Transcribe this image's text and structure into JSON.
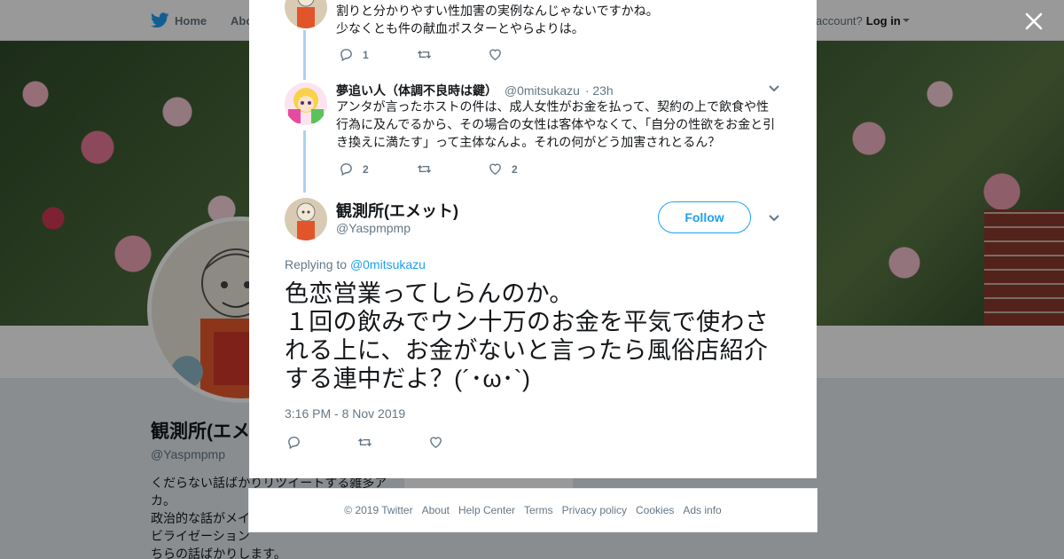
{
  "topbar": {
    "home_label": "Home",
    "about_label": "About",
    "account_prompt": "account?",
    "login_label": "Log in"
  },
  "profile_bg": {
    "name": "観測所(エメット)",
    "handle": "@Yaspmpmp",
    "bio": "くだらない話ばかりリツイートする雑多アカ。\n政治的な話がメインです。\nビライゼーション\nちらの話ばかりします。\nい、友に手を出したりはせん",
    "card_label": "Ads info"
  },
  "thread": [
    {
      "text": "割りと分かりやすい性加害の実例なんじゃないですかね。\n少なくとも件の献血ポスターとやらよりは。",
      "reply_count": "1",
      "retweet_count": "",
      "like_count": ""
    },
    {
      "name": "夢追い人（体調不良時は鍵）",
      "handle": "@0mitsukazu",
      "time": "· 23h",
      "text": "アンタが言ったホストの件は、成人女性がお金を払って、契約の上で飲食や性行為に及んでるから、その場合の女性は客体やなくて、「自分の性欲をお金と引き換えに満たす」って主体なんよ。それの何がどう加害されとるん？",
      "reply_count": "2",
      "retweet_count": "",
      "like_count": "2"
    }
  ],
  "main_tweet": {
    "name": "観測所(エメット)",
    "handle": "@Yaspmpmp",
    "follow_label": "Follow",
    "replying_prefix": "Replying to",
    "replying_handle": "@0mitsukazu",
    "text": "色恋営業ってしらんのか。\n１回の飲みでウン十万のお金を平気で使わされる上に、お金がないと言ったら風俗店紹介する連中だよ？(´･ω･`)",
    "timestamp": "3:16 PM - 8 Nov 2019"
  },
  "footer": {
    "links": [
      "© 2019 Twitter",
      "About",
      "Help Center",
      "Terms",
      "Privacy policy",
      "Cookies",
      "Ads info"
    ]
  },
  "colors": {
    "accent": "#1da1f2",
    "thread_line": "#a8d3f0",
    "secondary_text": "#657786"
  },
  "icons": [
    "twitter-bird-icon",
    "close-icon",
    "reply-icon",
    "retweet-icon",
    "like-icon",
    "chevron-down-icon"
  ]
}
